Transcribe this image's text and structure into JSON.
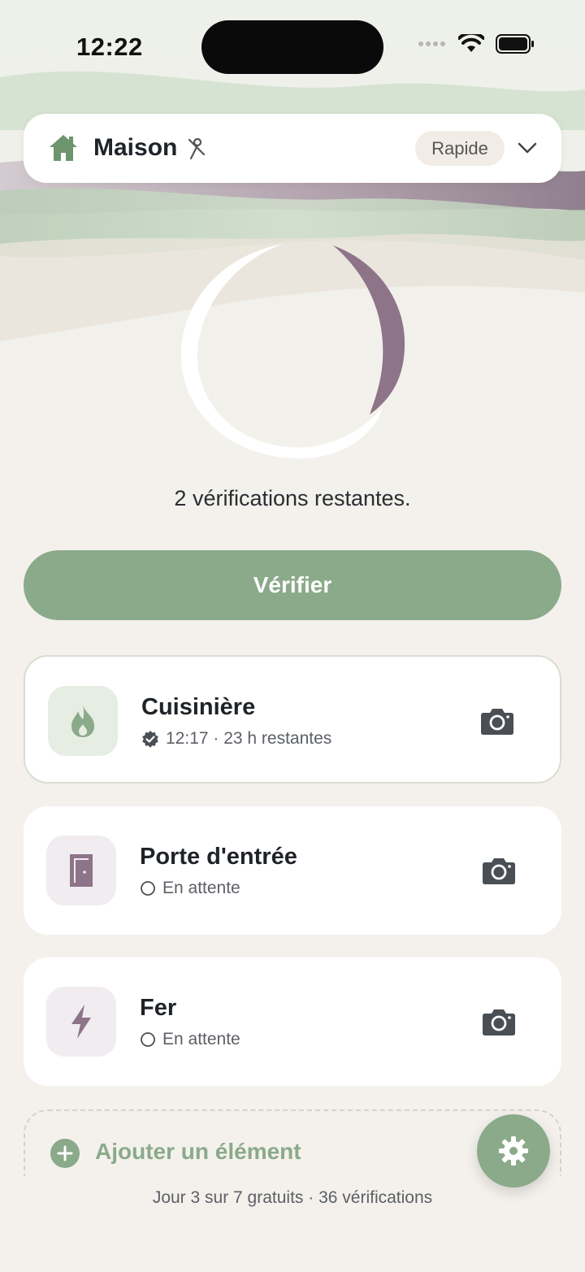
{
  "status_bar": {
    "time": "12:22",
    "icons": [
      "signal-icon",
      "wifi-icon",
      "battery-icon"
    ]
  },
  "location": {
    "name": "Maison",
    "mode": "Rapide",
    "icon": "home-icon",
    "pin_icon": "pin-icon"
  },
  "progress": {
    "remaining_text": "2 vérifications restantes."
  },
  "verify_button": {
    "label": "Vérifier"
  },
  "items": [
    {
      "title": "Cuisinière",
      "status": "12:17 · 23 h restantes",
      "icon": "flame-icon",
      "status_icon": "verified-badge-icon",
      "state": "verified",
      "icon_bg": "#e6ede3",
      "icon_color": "#8aaa8a"
    },
    {
      "title": "Porte d'entrée",
      "status": "En attente",
      "icon": "door-icon",
      "status_icon": "pending-circle-icon",
      "state": "pending",
      "icon_bg": "#f0ecef",
      "icon_color": "#8e7488"
    },
    {
      "title": "Fer",
      "status": "En attente",
      "icon": "lightning-icon",
      "status_icon": "pending-circle-icon",
      "state": "pending",
      "icon_bg": "#f0ecef",
      "icon_color": "#8e7488"
    }
  ],
  "add_item": {
    "label": "Ajouter un élément"
  },
  "footer": {
    "text": "Jour 3 sur 7 gratuits · 36 vérifications"
  },
  "colors": {
    "accent": "#8aaa8a",
    "secondary": "#8e7488",
    "background": "#f4f1ec"
  }
}
